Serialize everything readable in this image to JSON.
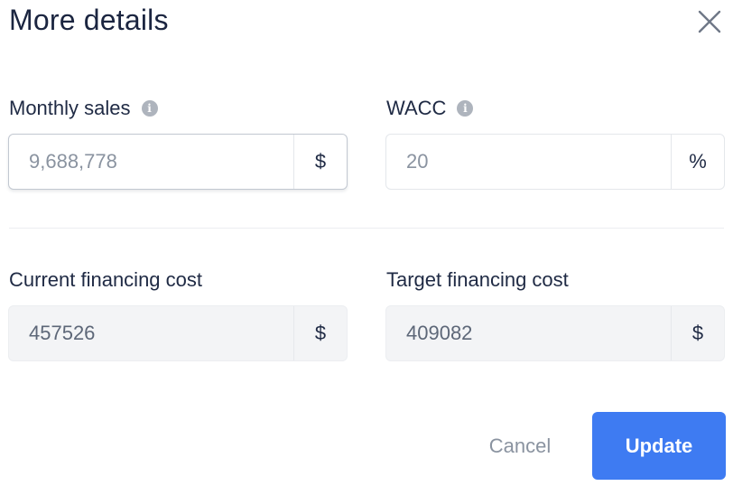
{
  "modal": {
    "title": "More details"
  },
  "fields": {
    "monthly_sales": {
      "label": "Monthly sales",
      "placeholder": "9,688,778",
      "suffix": "$"
    },
    "wacc": {
      "label": "WACC",
      "placeholder": "20",
      "suffix": "%"
    },
    "current_financing_cost": {
      "label": "Current financing cost",
      "value": "457526",
      "suffix": "$"
    },
    "target_financing_cost": {
      "label": "Target financing cost",
      "value": "409082",
      "suffix": "$"
    }
  },
  "actions": {
    "cancel_label": "Cancel",
    "update_label": "Update"
  },
  "icons": {
    "close": "close-icon",
    "info": "info-icon",
    "info_glyph": "i"
  },
  "colors": {
    "primary": "#3e7bf2",
    "title": "#1b2540",
    "muted": "#8a93a0",
    "readonly_bg": "#f3f4f6"
  }
}
